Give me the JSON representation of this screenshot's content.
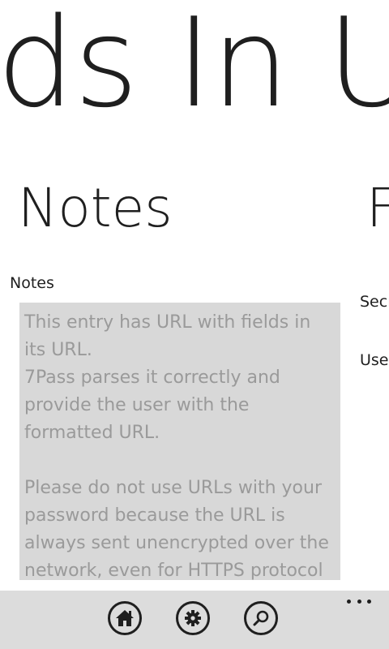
{
  "panorama": {
    "title": "ds In U"
  },
  "sections": {
    "notes_header": "Notes",
    "next_header": "F"
  },
  "notes": {
    "label": "Notes",
    "content": "This entry has URL with fields in its URL.\n7Pass parses it correctly and provide the user with the formatted URL.\n\nPlease do not use URLs with your password because the URL is always sent unencrypted over the network, even for HTTPS protocol"
  },
  "next_panel": {
    "secret_label": "Secr",
    "user_label": "User"
  },
  "app_bar": {
    "buttons": [
      {
        "icon": "home-icon"
      },
      {
        "icon": "gear-icon"
      },
      {
        "icon": "search-icon"
      }
    ],
    "more_icon": "ellipsis-icon",
    "colors": {
      "bar": "#dcdcdc",
      "foreground": "#1f1f1f"
    }
  }
}
